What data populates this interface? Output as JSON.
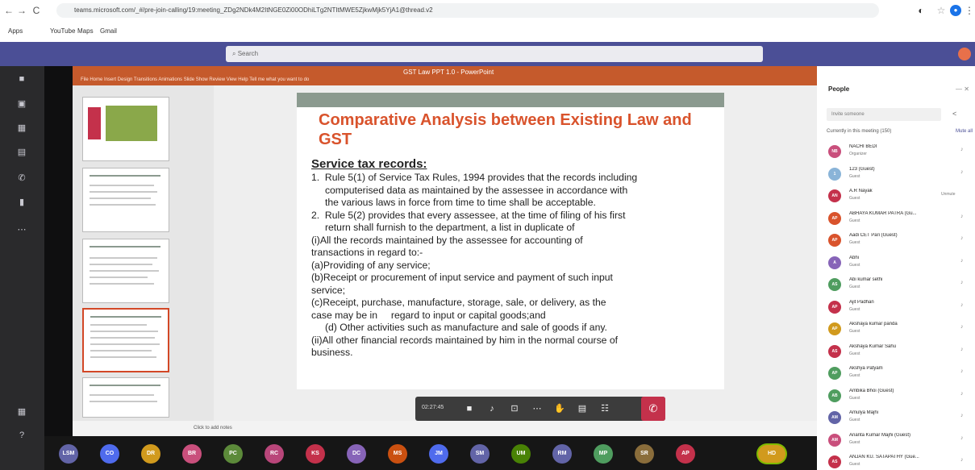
{
  "browser": {
    "back": "←",
    "forward": "→",
    "reload": "C",
    "url": "teams.microsoft.com/_#/pre-join-calling/19:meeting_ZDg2NDk4M2ItNGE0Zi00ODhiLTg2NTItMWE5ZjkwMjk5YjA1@thread.v2",
    "bookmarks": [
      "Apps",
      "YouTube",
      "Maps",
      "Gmail"
    ]
  },
  "teams": {
    "search_placeholder": "Search"
  },
  "rail": {
    "icons": [
      "activity-icon",
      "chat-icon",
      "teams-icon",
      "calendar-icon",
      "calls-icon",
      "files-icon",
      "more-icon",
      "apps-icon",
      "help-icon"
    ]
  },
  "ppt": {
    "window_title": "GST Law PPT 1.0 - PowerPoint",
    "menu": "File   Home   Insert   Design   Transitions   Animations   Slide Show   Review   View   Help   Tell me what you want to do"
  },
  "slide": {
    "title": "Comparative Analysis between Existing Law and GST",
    "subtitle": "Service tax records:",
    "body": [
      "1.  Rule 5(1) of Service Tax Rules, 1994 provides that the records including\n     computerised data as maintained by the assessee in accordance with\n     the various laws in force from time to time shall be acceptable.",
      "",
      "2.  Rule 5(2) provides that every assessee, at the time of filing of his first\n     return shall furnish to the department, a list in duplicate of",
      "(i)All the records maintained by the assessee for accounting of\ntransactions in regard to:-",
      "(a)Providing of any service;",
      "(b)Receipt or procurement of input service and payment of such input\nservice;",
      "(c)Receipt, purchase, manufacture, storage, sale, or delivery, as the\ncase may be in     regard to input or capital goods;and",
      "     (d) Other activities such as manufacture and sale of goods if any.",
      "(ii)All other financial records maintained by him in the normal course of\nbusiness."
    ],
    "notes_hint": "Click to add notes"
  },
  "call": {
    "timer": "02:27:45",
    "controls": [
      "camera-icon",
      "mic-icon",
      "share-icon",
      "more-icon",
      "raise-hand-icon",
      "chat-icon",
      "participants-icon"
    ],
    "leave_icon": "hang-up-icon"
  },
  "participants_bar": [
    {
      "initials": "LSM",
      "color": "#6264a7"
    },
    {
      "initials": "CO",
      "color": "#4f6bed"
    },
    {
      "initials": "DR",
      "color": "#d19a1d"
    },
    {
      "initials": "BR",
      "color": "#c94f7c"
    },
    {
      "initials": "PC",
      "color": "#5c8a3a"
    },
    {
      "initials": "RC",
      "color": "#b9467a"
    },
    {
      "initials": "KS",
      "color": "#c4314b"
    },
    {
      "initials": "DC",
      "color": "#8764b8"
    },
    {
      "initials": "MS",
      "color": "#ca5010"
    },
    {
      "initials": "JM",
      "color": "#4f6bed"
    },
    {
      "initials": "SM",
      "color": "#6264a7"
    },
    {
      "initials": "UM",
      "color": "#498205"
    },
    {
      "initials": "RM",
      "color": "#6264a7"
    },
    {
      "initials": "MP",
      "color": "#4f9d5f"
    },
    {
      "initials": "SR",
      "color": "#8a6d3b"
    },
    {
      "initials": "AP",
      "color": "#c4314b"
    },
    {
      "initials": "HD",
      "color": "#d19a1d"
    }
  ],
  "people": {
    "title": "People",
    "invite_placeholder": "Invite someone",
    "section": "Currently in this meeting (150)",
    "mute_all": "Mute all",
    "list": [
      {
        "initials": "NB",
        "name": "NACHI BEDI",
        "role": "Organizer",
        "color": "#c94f7c",
        "extra": ""
      },
      {
        "initials": "1",
        "name": "123 (Guest)",
        "role": "Guest",
        "color": "#8ab4d8",
        "extra": ""
      },
      {
        "initials": "AN",
        "name": "A.R Nayak",
        "role": "Guest",
        "color": "#c4314b",
        "extra": "Unmute"
      },
      {
        "initials": "AP",
        "name": "ABHAYA KUMAR PATRA (Gu...",
        "role": "Guest",
        "color": "#d9532c",
        "extra": ""
      },
      {
        "initials": "AP",
        "name": "Aadi CET Pari (Guest)",
        "role": "Guest",
        "color": "#d9532c",
        "extra": ""
      },
      {
        "initials": "A",
        "name": "Abhi",
        "role": "Guest",
        "color": "#8764b8",
        "extra": ""
      },
      {
        "initials": "AS",
        "name": "Abi kumar sethi",
        "role": "Guest",
        "color": "#4f9d5f",
        "extra": ""
      },
      {
        "initials": "AP",
        "name": "Ajit Padhan",
        "role": "Guest",
        "color": "#c4314b",
        "extra": ""
      },
      {
        "initials": "AP",
        "name": "Akshaya kumar panda",
        "role": "Guest",
        "color": "#d19a1d",
        "extra": ""
      },
      {
        "initials": "AS",
        "name": "Akshaya Kumar Sahu",
        "role": "Guest",
        "color": "#c4314b",
        "extra": ""
      },
      {
        "initials": "AP",
        "name": "Akshya Patyam",
        "role": "Guest",
        "color": "#4f9d5f",
        "extra": ""
      },
      {
        "initials": "AB",
        "name": "Ambika Bhoi (Guest)",
        "role": "Guest",
        "color": "#4f9d5f",
        "extra": ""
      },
      {
        "initials": "AM",
        "name": "Amulya Majhi",
        "role": "Guest",
        "color": "#6264a7",
        "extra": ""
      },
      {
        "initials": "AM",
        "name": "Ananta Kumar Majhi (Guest)",
        "role": "Guest",
        "color": "#c94f7c",
        "extra": ""
      },
      {
        "initials": "AS",
        "name": "ANJAN KU. SATAPATHY (Gue...",
        "role": "Guest",
        "color": "#c4314b",
        "extra": ""
      }
    ]
  }
}
